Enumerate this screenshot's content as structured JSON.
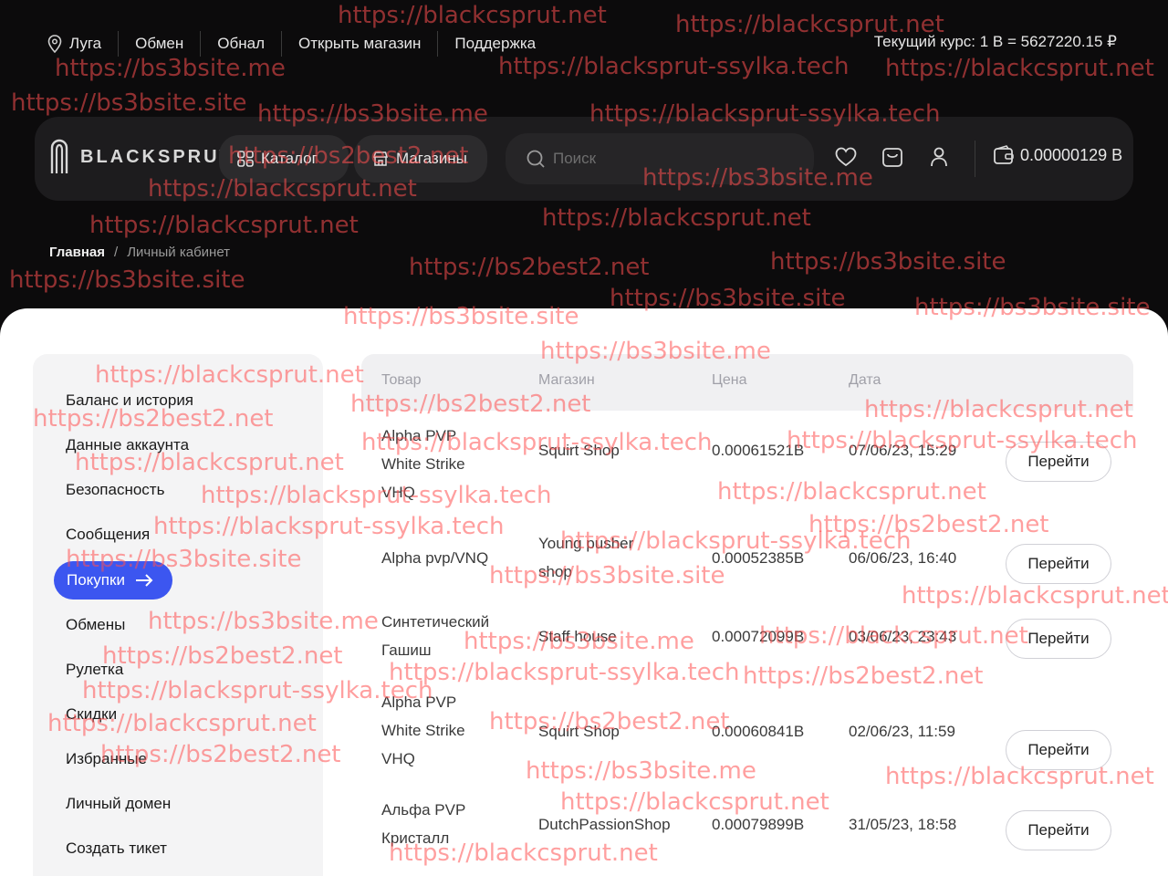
{
  "header": {
    "links": [
      {
        "label": "Луга",
        "icon": "location-pin-icon"
      },
      {
        "label": "Обмен"
      },
      {
        "label": "Обнал"
      },
      {
        "label": "Открыть магазин"
      },
      {
        "label": "Поддержка"
      }
    ],
    "rate": "Текущий курс: 1 Β = 5627220.15 ₽"
  },
  "navbar": {
    "logo_text": "BLACKSPRUT",
    "catalog_label": "Каталог",
    "shops_label": "Магазины",
    "search_placeholder": "Поиск",
    "balance": "0.00000129 Β"
  },
  "breadcrumb": {
    "home": "Главная",
    "separator": "/",
    "current": "Личный кабинет"
  },
  "sidebar": {
    "items": [
      {
        "label": "Баланс и история"
      },
      {
        "label": "Данные аккаунта"
      },
      {
        "label": "Безопасность"
      },
      {
        "label": "Сообщения"
      },
      {
        "label": "Покупки",
        "active": true
      },
      {
        "label": "Обмены"
      },
      {
        "label": "Рулетка"
      },
      {
        "label": "Скидки"
      },
      {
        "label": "Избранные"
      },
      {
        "label": "Личный домен"
      },
      {
        "label": "Создать тикет"
      }
    ]
  },
  "table": {
    "headers": {
      "item": "Товар",
      "shop": "Магазин",
      "price": "Цена",
      "date": "Дата"
    },
    "rows": [
      {
        "item": [
          "Alpha PVP",
          "White Strike",
          "VHQ"
        ],
        "shop": [
          "Squirt Shop"
        ],
        "price": "0.00061521Β",
        "date": "07/06/23, 15:29",
        "action": "Перейти"
      },
      {
        "item": [
          "Alpha pvp/VNQ"
        ],
        "shop": [
          "Young pusher",
          "shop"
        ],
        "price": "0.00052385Β",
        "date": "06/06/23, 16:40",
        "action": "Перейти"
      },
      {
        "item": [
          "Синтетический",
          "Гашиш"
        ],
        "shop": [
          "Staff house"
        ],
        "price": "0.00072099Β",
        "date": "03/06/23, 23:43",
        "action": "Перейти"
      },
      {
        "item": [
          "Alpha PVP",
          "White Strike",
          "VHQ"
        ],
        "shop": [
          "Squirt Shop"
        ],
        "price": "0.00060841Β",
        "date": "02/06/23, 11:59",
        "action": "Перейти"
      },
      {
        "item": [
          "Альфа PVP",
          "Кристалл"
        ],
        "shop": [
          "DutchPassionShop"
        ],
        "price": "0.00079899Β",
        "date": "31/05/23, 18:58",
        "action": "Перейти"
      }
    ]
  },
  "watermarks": [
    "https://blackcsprut.net",
    "https://blackcsprut.net",
    "https://bs3bsite.me",
    "https://blacksprut-ssylka.tech",
    "https://blackcsprut.net",
    "https://bs3bsite.site",
    "https://bs3bsite.me",
    "https://blacksprut-ssylka.tech",
    "https://bs2best2.net",
    "https://blackcsprut.net",
    "https://bs3bsite.me",
    "https://blackcsprut.net",
    "https://blackcsprut.net",
    "https://bs2best2.net",
    "https://bs3bsite.site",
    "https://bs3bsite.site",
    "https://bs3bsite.site",
    "https://bs3bsite.site",
    "https://bs3bsite.site",
    "https://blackcsprut.net",
    "https://bs3bsite.me",
    "https://bs2best2.net",
    "https://bs2best2.net",
    "https://blacksprut-ssylka.tech",
    "https://blackcsprut.net",
    "https://blackcsprut.net",
    "https://blacksprut-ssylka.tech",
    "https://blacksprut-ssylka.tech",
    "https://blackcsprut.net",
    "https://blacksprut-ssylka.tech",
    "https://bs2best2.net",
    "https://bs3bsite.site",
    "https://blacksprut-ssylka.tech",
    "https://bs3bsite.site",
    "https://blackcsprut.net",
    "https://bs3bsite.me",
    "https://bs3bsite.me",
    "https://blackcsprut.net",
    "https://bs2best2.net",
    "https://blacksprut-ssylka.tech",
    "https://bs2best2.net",
    "https://blacksprut-ssylka.tech",
    "https://blackcsprut.net",
    "https://bs2best2.net",
    "https://bs2best2.net",
    "https://bs3bsite.me",
    "https://blackcsprut.net",
    "https://blackcsprut.net",
    "https://blackcsprut.net"
  ],
  "colors": {
    "accent": "#3c56f0",
    "watermark": "#ff5050",
    "dark_bg": "#0c0b0c",
    "nav_bg": "#1d1c1e"
  }
}
